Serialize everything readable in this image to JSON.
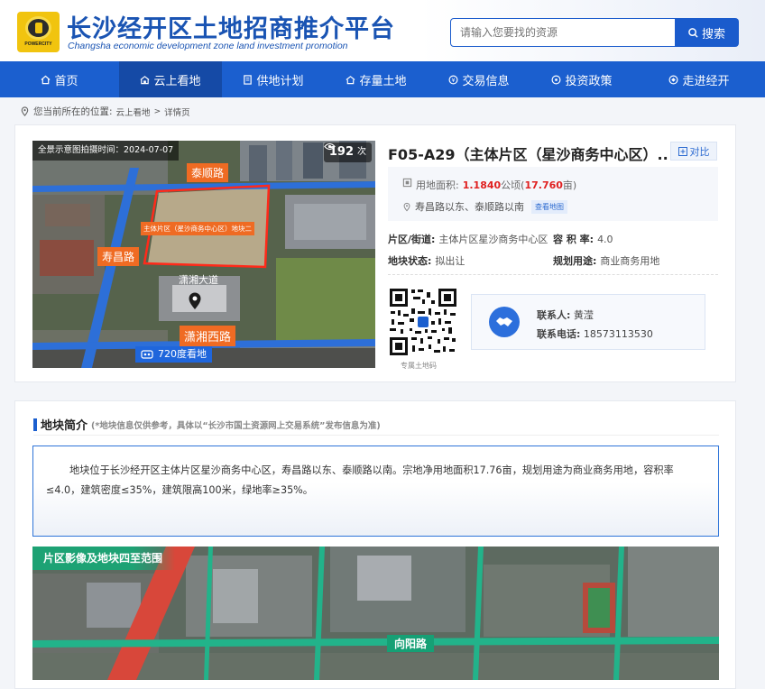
{
  "header": {
    "title": "长沙经开区土地招商推介平台",
    "subtitle": "Changsha economic development zone land investment promotion",
    "logo_text": "POWERCITY",
    "search_placeholder": "请输入您要找的资源",
    "search_label": "搜索"
  },
  "nav": [
    {
      "label": "首页",
      "icon": "home-icon",
      "active": false
    },
    {
      "label": "云上看地",
      "icon": "cloud-land-icon",
      "active": true
    },
    {
      "label": "供地计划",
      "icon": "plan-icon",
      "active": false
    },
    {
      "label": "存量土地",
      "icon": "land-stock-icon",
      "active": false
    },
    {
      "label": "交易信息",
      "icon": "trade-icon",
      "active": false
    },
    {
      "label": "投资政策",
      "icon": "policy-icon",
      "active": false
    },
    {
      "label": "走进经开",
      "icon": "enter-icon",
      "active": false
    }
  ],
  "breadcrumb": {
    "prefix": "您当前所在的位置:",
    "items": [
      "云上看地",
      "详情页"
    ],
    "separator": ">"
  },
  "photo": {
    "caption": "全景示意图拍摄时间：2024-07-07",
    "views_count": "192",
    "views_unit": "次",
    "road_labels": [
      "泰顺路",
      "寿昌路",
      "潇湘西路"
    ],
    "plot_label": "主体片区（星沙商务中心区）地块二",
    "building_label": "潇湘大道",
    "pano_label": "720度看地"
  },
  "parcel": {
    "title": "F05-A29（主体片区（星沙商务中心区）...",
    "compare_label": "对比",
    "area_label": "用地面积:",
    "area_ha": "1.1840",
    "area_ha_unit": "公顷(",
    "area_mu": "17.760",
    "area_mu_unit": "亩)",
    "location": "寿昌路以东、泰顺路以南",
    "map_tag": "查看地图",
    "district_label": "片区/街道:",
    "district_value": "主体片区星沙商务中心区",
    "far_label": "容 积 率:",
    "far_value": "4.0",
    "status_label": "地块状态:",
    "status_value": "拟出让",
    "usage_label": "规划用途:",
    "usage_value": "商业商务用地"
  },
  "qr": {
    "caption": "专属土地码"
  },
  "contact": {
    "name_label": "联系人:",
    "name": "黄滢",
    "phone_label": "联系电话:",
    "phone": "18573113530"
  },
  "intro": {
    "title": "地块简介",
    "note": "(*地块信息仅供参考，具体以“长沙市国土资源网上交易系统”发布信息为准)",
    "text": "地块位于长沙经开区主体片区星沙商务中心区，寿昌路以东、泰顺路以南。宗地净用地面积17.76亩，规划用途为商业商务用地，容积率≤4.0，建筑密度≤35%，建筑限高100米，绿地率≥35%。"
  },
  "map2": {
    "caption": "片区影像及地块四至范围",
    "road": "向阳路"
  },
  "colors": {
    "primary": "#1b5fcf",
    "nav_active": "#154aa6",
    "highlight": "#e02020",
    "label_orange": "#ef6b23",
    "green": "#1da274"
  }
}
